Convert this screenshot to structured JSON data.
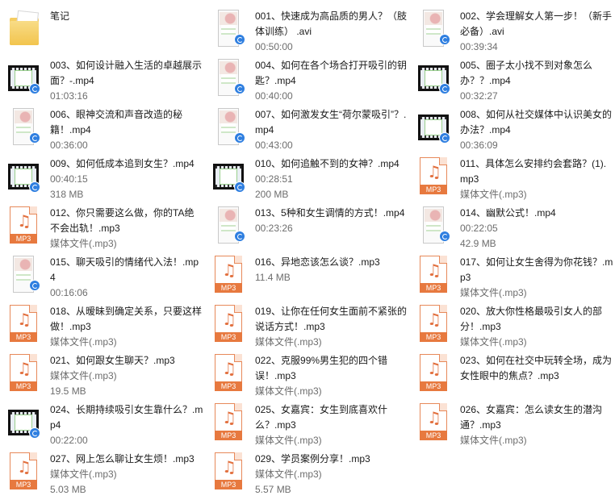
{
  "items": [
    {
      "kind": "folder",
      "icon": "folder-icon",
      "name": "笔记",
      "meta1": "",
      "meta2": ""
    },
    {
      "kind": "phone",
      "icon": "video-thumbnail-icon",
      "name": "001、快速成为高品质的男人？（肢体训练） .avi",
      "meta1": "00:50:00",
      "meta2": ""
    },
    {
      "kind": "phone",
      "icon": "video-thumbnail-icon",
      "name": "002、学会理解女人第一步！（新手必备）.avi",
      "meta1": "00:39:34",
      "meta2": ""
    },
    {
      "kind": "video",
      "icon": "video-thumbnail-icon",
      "name": "003、如何设计融入生活的卓越展示面？-.mp4",
      "meta1": "01:03:16",
      "meta2": ""
    },
    {
      "kind": "phone",
      "icon": "video-thumbnail-icon",
      "name": "004、如何在各个场合打开吸引的钥匙？.mp4",
      "meta1": "00:40:00",
      "meta2": ""
    },
    {
      "kind": "video",
      "icon": "video-thumbnail-icon",
      "name": "005、圈子太小找不到对象怎么办？？.mp4",
      "meta1": "00:32:27",
      "meta2": ""
    },
    {
      "kind": "phone",
      "icon": "video-thumbnail-icon",
      "name": "006、眼神交流和声音改造的秘籍！.mp4",
      "meta1": "00:36:00",
      "meta2": ""
    },
    {
      "kind": "phone",
      "icon": "video-thumbnail-icon",
      "name": "007、如何激发女生“荷尔蒙吸引”？.mp4",
      "meta1": "00:43:00",
      "meta2": ""
    },
    {
      "kind": "video",
      "icon": "video-thumbnail-icon",
      "name": "008、如何从社交媒体中认识美女的办法？.mp4",
      "meta1": "00:36:09",
      "meta2": ""
    },
    {
      "kind": "video",
      "icon": "video-thumbnail-icon",
      "name": "009、如何低成本追到女生？.mp4",
      "meta1": "00:40:15",
      "meta2": "318 MB"
    },
    {
      "kind": "video",
      "icon": "video-thumbnail-icon",
      "name": "010、如何追触不到的女神？.mp4",
      "meta1": "00:28:51",
      "meta2": "200 MB"
    },
    {
      "kind": "mp3",
      "icon": "mp3-file-icon",
      "name": "011、具体怎么安排约会套路？(1).mp3",
      "meta1": "媒体文件(.mp3)",
      "meta2": ""
    },
    {
      "kind": "mp3",
      "icon": "mp3-file-icon",
      "name": "012、你只需要这么做，你的TA绝不会出轨！.mp3",
      "meta1": "媒体文件(.mp3)",
      "meta2": ""
    },
    {
      "kind": "phone",
      "icon": "video-thumbnail-icon",
      "name": "013、5种和女生调情的方式！.mp4",
      "meta1": "00:23:26",
      "meta2": ""
    },
    {
      "kind": "phone",
      "icon": "video-thumbnail-icon",
      "name": "014、幽默公式！.mp4",
      "meta1": "00:22:05",
      "meta2": "42.9 MB"
    },
    {
      "kind": "phone",
      "icon": "video-thumbnail-icon",
      "name": "015、聊天吸引的情绪代入法！.mp4",
      "meta1": "00:16:06",
      "meta2": ""
    },
    {
      "kind": "mp3",
      "icon": "mp3-file-icon",
      "name": "016、异地恋该怎么谈？.mp3",
      "meta1": "11.4 MB",
      "meta2": ""
    },
    {
      "kind": "mp3",
      "icon": "mp3-file-icon",
      "name": "017、如何让女生舍得为你花钱？.mp3",
      "meta1": "媒体文件(.mp3)",
      "meta2": ""
    },
    {
      "kind": "mp3",
      "icon": "mp3-file-icon",
      "name": "018、从暧昧到确定关系，只要这样做！.mp3",
      "meta1": "媒体文件(.mp3)",
      "meta2": ""
    },
    {
      "kind": "mp3",
      "icon": "mp3-file-icon",
      "name": "019、让你在任何女生面前不紧张的说话方式！.mp3",
      "meta1": "媒体文件(.mp3)",
      "meta2": ""
    },
    {
      "kind": "mp3",
      "icon": "mp3-file-icon",
      "name": "020、放大你性格最吸引女人的部分！.mp3",
      "meta1": "媒体文件(.mp3)",
      "meta2": ""
    },
    {
      "kind": "mp3",
      "icon": "mp3-file-icon",
      "name": "021、如何跟女生聊天？.mp3",
      "meta1": "媒体文件(.mp3)",
      "meta2": "19.5 MB"
    },
    {
      "kind": "mp3",
      "icon": "mp3-file-icon",
      "name": "022、克服99%男生犯的四个错误！.mp3",
      "meta1": "媒体文件(.mp3)",
      "meta2": ""
    },
    {
      "kind": "mp3",
      "icon": "mp3-file-icon",
      "name": "023、如何在社交中玩转全场，成为女性眼中的焦点？.mp3",
      "meta1": "",
      "meta2": ""
    },
    {
      "kind": "video",
      "icon": "video-thumbnail-icon",
      "name": "024、长期持续吸引女生靠什么？.mp4",
      "meta1": "00:22:00",
      "meta2": ""
    },
    {
      "kind": "mp3",
      "icon": "mp3-file-icon",
      "name": "025、女嘉宾：女生到底喜欢什么？.mp3",
      "meta1": "媒体文件(.mp3)",
      "meta2": ""
    },
    {
      "kind": "mp3",
      "icon": "mp3-file-icon",
      "name": "026、女嘉宾：怎么读女生的潜沟通？.mp3",
      "meta1": "媒体文件(.mp3)",
      "meta2": ""
    },
    {
      "kind": "mp3",
      "icon": "mp3-file-icon",
      "name": "027、网上怎么聊让女生烦！.mp3",
      "meta1": "媒体文件(.mp3)",
      "meta2": "5.03 MB"
    },
    {
      "kind": "mp3",
      "icon": "mp3-file-icon",
      "name": "029、学员案例分享！.mp3",
      "meta1": "媒体文件(.mp3)",
      "meta2": "5.57 MB"
    }
  ],
  "mp3_band_label": "MP3"
}
